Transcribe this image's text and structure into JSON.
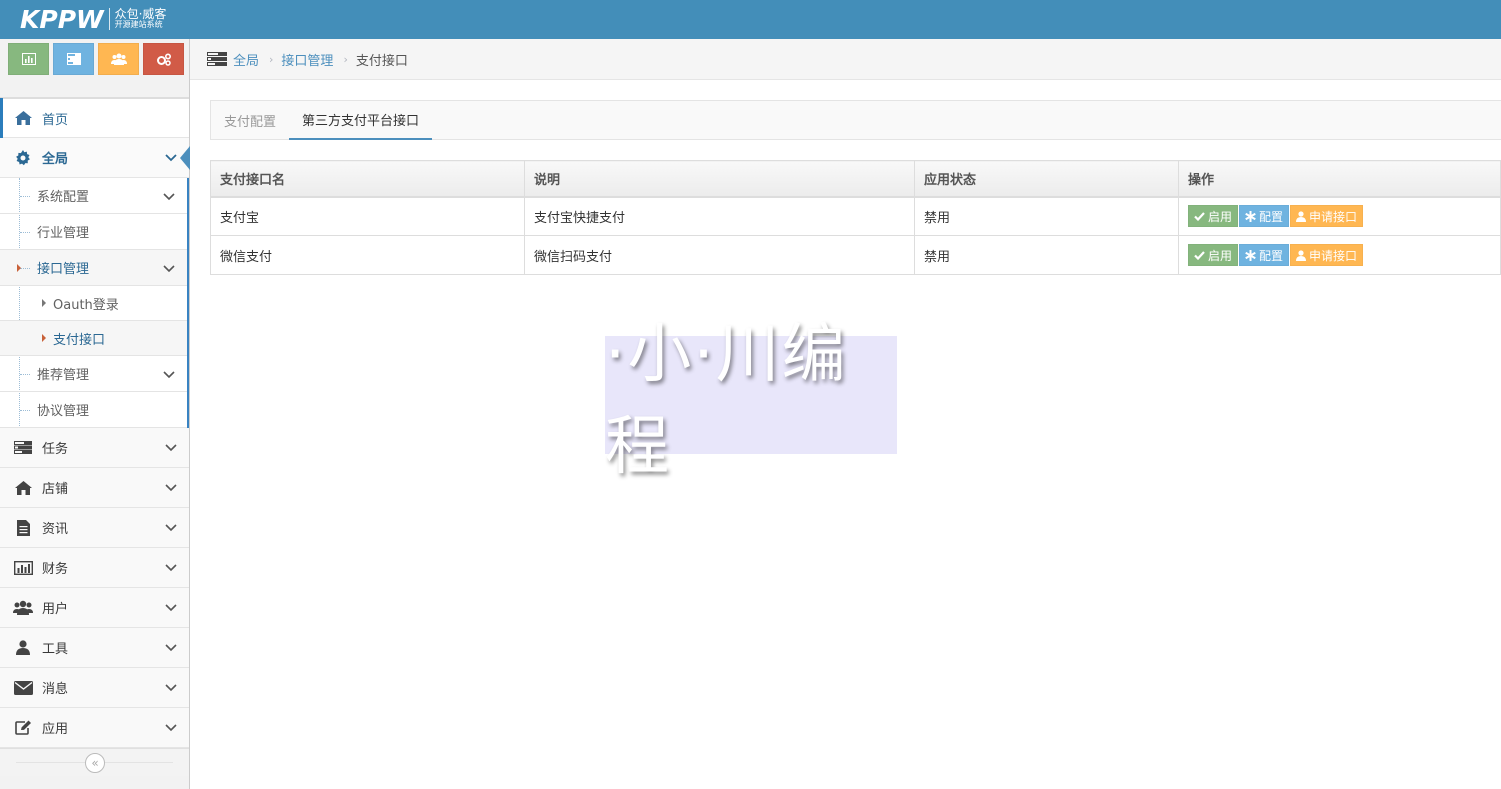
{
  "header": {
    "logo_text": "KPPW",
    "logo_sub1": "众包·威客",
    "logo_sub2": "开源建站系统"
  },
  "shortcuts": [
    {
      "icon": "bar-chart-icon",
      "color": "#87b87f"
    },
    {
      "icon": "tasks-icon",
      "color": "#6fb3e0"
    },
    {
      "icon": "users-icon",
      "color": "#ffb752"
    },
    {
      "icon": "cogs-icon",
      "color": "#d15b47"
    }
  ],
  "sidebar": {
    "home": "首页",
    "global": "全局",
    "global_sub": {
      "system_config": "系统配置",
      "industry": "行业管理",
      "interface": "接口管理",
      "oauth": "Oauth登录",
      "payment": "支付接口",
      "recommend": "推荐管理",
      "agreement": "协议管理"
    },
    "items": {
      "task": "任务",
      "shop": "店铺",
      "news": "资讯",
      "finance": "财务",
      "user": "用户",
      "tools": "工具",
      "message": "消息",
      "apps": "应用"
    }
  },
  "breadcrumb": {
    "root": "全局",
    "parent": "接口管理",
    "current": "支付接口"
  },
  "tabs": {
    "config": "支付配置",
    "third_party": "第三方支付平台接口"
  },
  "table": {
    "headers": {
      "name": "支付接口名",
      "desc": "说明",
      "status": "应用状态",
      "ops": "操作"
    },
    "rows": [
      {
        "name": "支付宝",
        "desc": "支付宝快捷支付",
        "status": "禁用"
      },
      {
        "name": "微信支付",
        "desc": "微信扫码支付",
        "status": "禁用"
      }
    ],
    "actions": {
      "enable": "启用",
      "config": "配置",
      "apply": "申请接口"
    }
  },
  "watermark": "·小·川编程",
  "colors": {
    "topbar": "#438eb9",
    "accent": "#4c8fbd",
    "success": "#87b87f",
    "info": "#6fb3e0",
    "warning": "#ffb752",
    "danger": "#d15b47"
  }
}
